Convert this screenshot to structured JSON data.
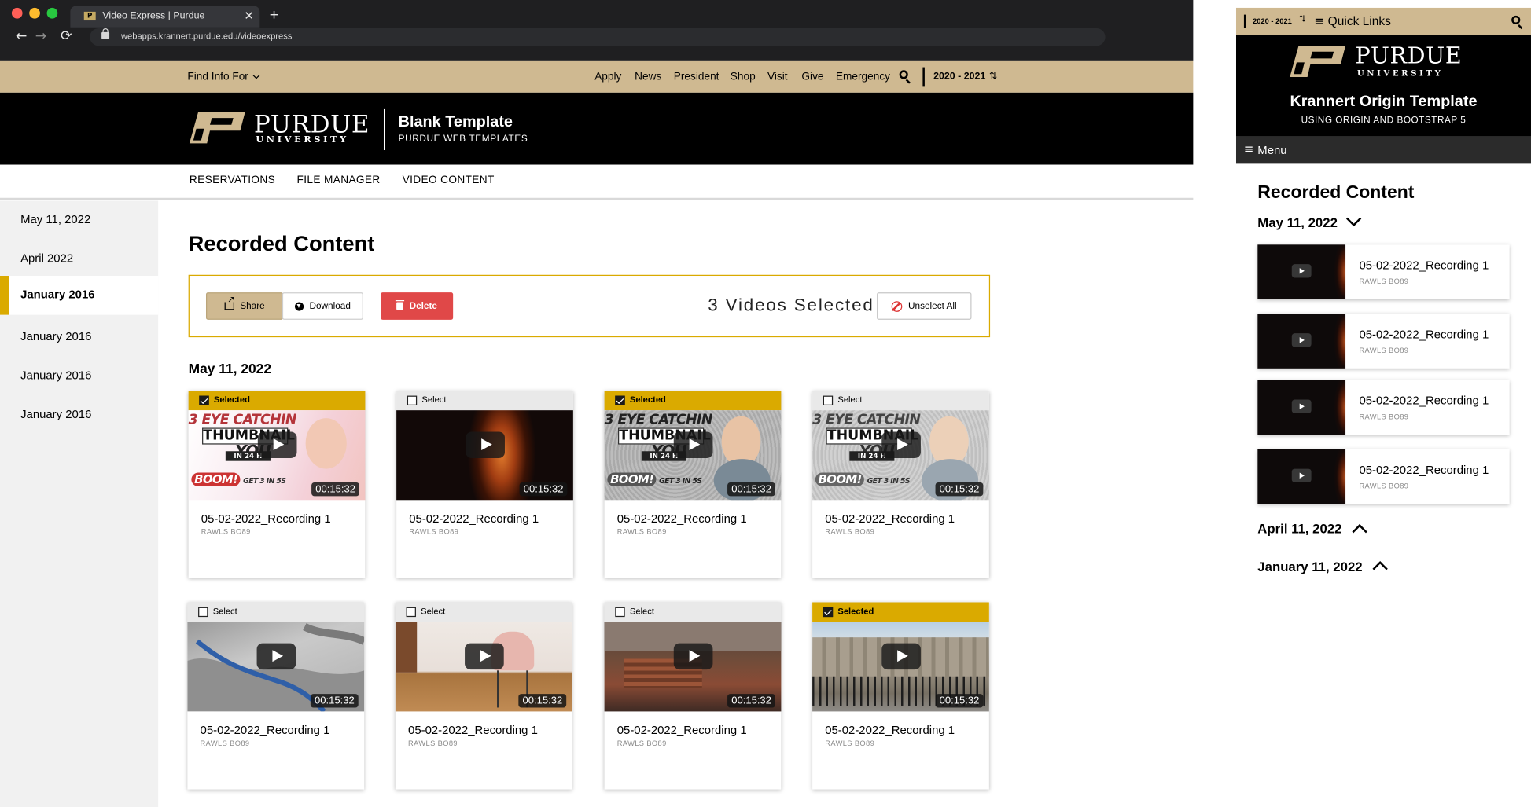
{
  "browser": {
    "tab_title": "Video Express | Purdue",
    "tab_favicon": "P",
    "tab_close": "✕",
    "new_tab": "+",
    "back": "←",
    "forward": "→",
    "reload": "⟳",
    "url": "webapps.krannert.purdue.edu/videoexpress",
    "traffic_colors": [
      "#fe5f57",
      "#febc2e",
      "#28c840"
    ]
  },
  "topbar": {
    "find_info": "Find Info For",
    "links": [
      "Apply",
      "News",
      "President",
      "Shop",
      "Visit",
      "Give",
      "Emergency"
    ],
    "year_select": "2020 - 2021",
    "year_arrows": "⇅"
  },
  "brand": {
    "wordmark": "PURDUE",
    "university": "UNIVERSITY",
    "registered": "®",
    "site_title": "Blank Template",
    "site_subtitle": "PURDUE WEB TEMPLATES"
  },
  "subnav": [
    "RESERVATIONS",
    "FILE MANAGER",
    "VIDEO CONTENT"
  ],
  "sidebar": [
    {
      "label": "May 11, 2022",
      "active": false
    },
    {
      "label": "April 2022",
      "active": false
    },
    {
      "label": "January 2016",
      "active": true
    },
    {
      "label": "January 2016",
      "active": false
    },
    {
      "label": "January 2016",
      "active": false
    },
    {
      "label": "January 2016",
      "active": false
    }
  ],
  "main": {
    "title": "Recorded Content",
    "actions": {
      "share": "Share",
      "download": "Download",
      "delete": "Delete",
      "selected_count": "3 Videos Selected",
      "unselect_all": "Unselect All"
    },
    "section_date": "May 11, 2022",
    "thumb_text": {
      "line1": "3 EYE CATCHIN",
      "line2": "THUMBNAIL",
      "line3": "YOU",
      "line4": "IN 24 H",
      "boom": "BOOM!",
      "get": "GET 3 IN 5S"
    },
    "videos": [
      {
        "selected": true,
        "head": "Selected",
        "thumb": "pink",
        "duration": "00:15:32",
        "title": "05-02-2022_Recording 1",
        "location": "RAWLS BO89"
      },
      {
        "selected": false,
        "head": "Select",
        "thumb": "fire",
        "duration": "00:15:32",
        "title": "05-02-2022_Recording 1",
        "location": "RAWLS BO89"
      },
      {
        "selected": true,
        "head": "Selected",
        "thumb": "comic",
        "duration": "00:15:32",
        "title": "05-02-2022_Recording 1",
        "location": "RAWLS BO89"
      },
      {
        "selected": false,
        "head": "Select",
        "thumb": "comic2",
        "duration": "00:15:32",
        "title": "05-02-2022_Recording 1",
        "location": "RAWLS BO89"
      },
      {
        "selected": false,
        "head": "Select",
        "thumb": "map",
        "duration": "00:15:32",
        "title": "05-02-2022_Recording 1",
        "location": "RAWLS BO89"
      },
      {
        "selected": false,
        "head": "Select",
        "thumb": "chair",
        "duration": "00:15:32",
        "title": "05-02-2022_Recording 1",
        "location": "RAWLS BO89"
      },
      {
        "selected": false,
        "head": "Select",
        "thumb": "hall",
        "duration": "00:15:32",
        "title": "05-02-2022_Recording 1",
        "location": "RAWLS BO89"
      },
      {
        "selected": true,
        "head": "Selected",
        "thumb": "palace",
        "duration": "00:15:32",
        "title": "05-02-2022_Recording 1",
        "location": "RAWLS BO89"
      }
    ]
  },
  "mobile": {
    "year_select": "2020 - 2021",
    "quick_links": "Quick Links",
    "menu": "Menu",
    "menu_icon": "≡",
    "template_title": "Krannert Origin Template",
    "template_subtitle": "USING ORIGIN AND BOOTSTRAP 5",
    "title": "Recorded Content",
    "sections": [
      {
        "date": "May 11, 2022",
        "expanded": true
      },
      {
        "date": "April 11, 2022",
        "expanded": false
      },
      {
        "date": "January 11, 2022",
        "expanded": false
      }
    ],
    "videos": [
      {
        "title": "05-02-2022_Recording 1",
        "location": "RAWLS BO89"
      },
      {
        "title": "05-02-2022_Recording 1",
        "location": "RAWLS BO89"
      },
      {
        "title": "05-02-2022_Recording 1",
        "location": "RAWLS BO89"
      },
      {
        "title": "05-02-2022_Recording 1",
        "location": "RAWLS BO89"
      }
    ]
  },
  "colors": {
    "gold": "#cfb991",
    "rush_gold": "#daaa00",
    "black": "#000000",
    "delete_red": "#e04848"
  }
}
